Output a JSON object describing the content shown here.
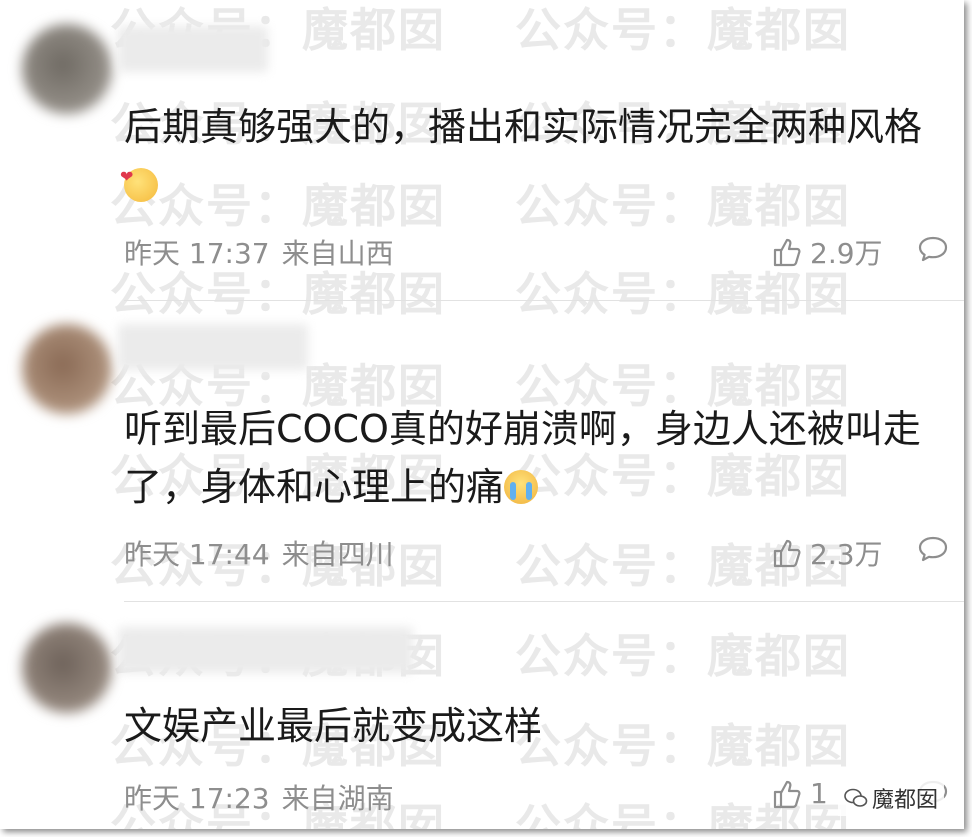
{
  "watermark": "公众号：魔都囡",
  "brand_badge": "魔都囡",
  "comments": [
    {
      "text": "后期真够强大的，播出和实际情况完全两种风格",
      "emoji": "heart-face-emoji",
      "time": "昨天 17:37",
      "location": "来自山西",
      "likes": "2.9万"
    },
    {
      "text": "听到最后COCO真的好崩溃啊，身边人还被叫走了，身体和心理上的痛",
      "emoji": "crying-face-emoji",
      "time": "昨天 17:44",
      "location": "来自四川",
      "likes": "2.3万"
    },
    {
      "text": "文娱产业最后就变成这样",
      "emoji": "",
      "time": "昨天 17:23",
      "location": "来自湖南",
      "likes": "1"
    }
  ]
}
